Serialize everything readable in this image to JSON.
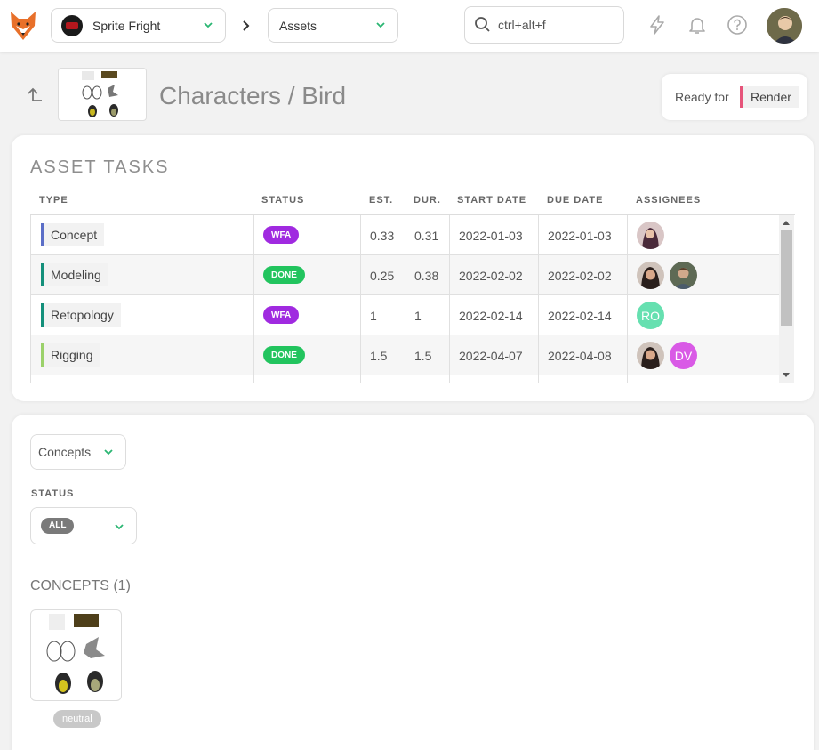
{
  "topbar": {
    "production": "Sprite Fright",
    "section": "Assets",
    "search_placeholder": "ctrl+alt+f"
  },
  "header": {
    "title": "Characters / Bird",
    "ready_for_label": "Ready for",
    "ready_for_value": "Render"
  },
  "tasks": {
    "section_title": "ASSET TASKS",
    "columns": {
      "type": "TYPE",
      "status": "STATUS",
      "est": "EST.",
      "dur": "DUR.",
      "start": "START DATE",
      "due": "DUE DATE",
      "assignees": "ASSIGNEES"
    },
    "rows": [
      {
        "type": "Concept",
        "type_color": "#5b6ec7",
        "status": "WFA",
        "status_color": "#a02ae0",
        "est": "0.33",
        "dur": "0.31",
        "start": "2022-01-03",
        "due": "2022-01-03"
      },
      {
        "type": "Modeling",
        "type_color": "#14907b",
        "status": "DONE",
        "status_color": "#22c45e",
        "est": "0.25",
        "dur": "0.38",
        "start": "2022-02-02",
        "due": "2022-02-02"
      },
      {
        "type": "Retopology",
        "type_color": "#14907b",
        "status": "WFA",
        "status_color": "#a02ae0",
        "est": "1",
        "dur": "1",
        "start": "2022-02-14",
        "due": "2022-02-14",
        "assignee_initials": "RO",
        "assignee_color": "#66e0b0"
      },
      {
        "type": "Rigging",
        "type_color": "#9bd16a",
        "status": "DONE",
        "status_color": "#22c45e",
        "est": "1.5",
        "dur": "1.5",
        "start": "2022-04-07",
        "due": "2022-04-08",
        "assignee_initials": "DV",
        "assignee_color": "#d95ae6"
      }
    ]
  },
  "concepts": {
    "filter_value": "Concepts",
    "status_label": "STATUS",
    "status_value": "ALL",
    "heading": "CONCEPTS (1)",
    "concept_status": "neutral"
  }
}
